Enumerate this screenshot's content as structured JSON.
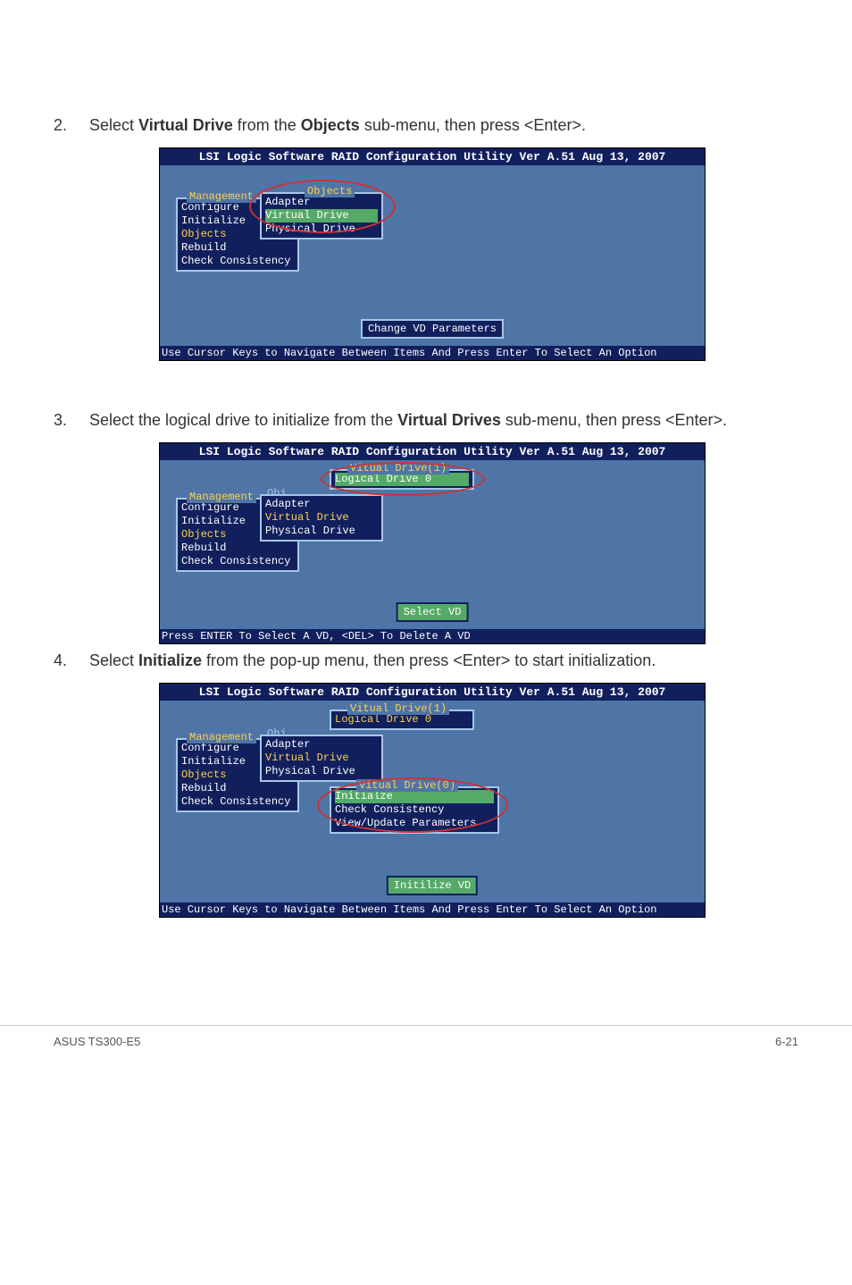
{
  "step2": {
    "num": "2.",
    "text_before": "Select ",
    "bold1": "Virtual Drive",
    "text_mid": " from the ",
    "bold2": "Objects",
    "text_after": " sub-menu, then press <Enter>."
  },
  "step3": {
    "num": "3.",
    "text_before": "Select the logical drive to initialize from the ",
    "bold1": "Virtual Drives",
    "text_after": " sub-menu, then press <Enter>."
  },
  "step4": {
    "num": "4.",
    "text_before": "Select ",
    "bold1": "Initialize",
    "text_after": " from the pop-up menu, then press <Enter> to start initialization."
  },
  "bios": {
    "header": "LSI Logic Software RAID Configuration Utility Ver A.51 Aug 13, 2007",
    "management_menu": {
      "title": "Management",
      "items": [
        "Configure",
        "Initialize",
        "Objects",
        "Rebuild",
        "Check Consistency"
      ]
    },
    "objects_menu": {
      "title": "Objects",
      "items": [
        "Adapter",
        "Virtual Drive",
        "Physical Drive"
      ]
    },
    "obj_label": "Obj",
    "vd1_menu": {
      "title": "Vitual Drive(1)",
      "items": [
        "Logical Drive 0"
      ]
    },
    "vd0_menu": {
      "title": "Vitual Drive(0)",
      "items": [
        "Initialze",
        "Check Consistency",
        "View/Update Parameters"
      ]
    },
    "hints": {
      "change_vd": "Change VD Parameters",
      "select_vd": "Select VD",
      "init_vd": "Initilize VD"
    },
    "footer1": "Use Cursor Keys to Navigate Between Items And Press Enter To Select An Option",
    "footer2": "Press ENTER To Select A VD, <DEL> To Delete A VD"
  },
  "page_footer": {
    "left": "ASUS TS300-E5",
    "right": "6-21"
  }
}
